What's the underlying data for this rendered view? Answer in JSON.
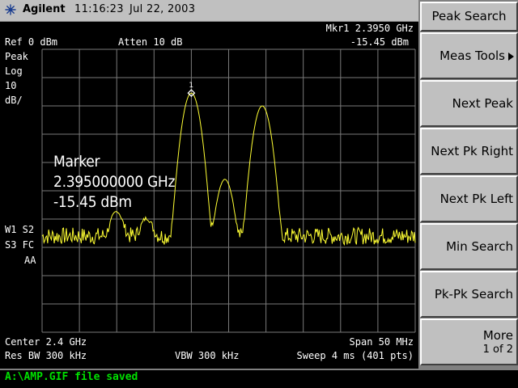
{
  "header": {
    "brand": "Agilent",
    "time": "11:16:23",
    "date": "Jul 22, 2003"
  },
  "display": {
    "ref_level": "Ref 0 dBm",
    "atten": "Atten 10 dB",
    "mkr_label": "Mkr1  2.3950 GHz",
    "mkr_amp": "-15.45 dBm",
    "detector": "Peak",
    "scale_type": "Log",
    "scale_value": "10",
    "scale_unit": "dB/",
    "trace_info_1": "W1  S2",
    "trace_info_2": "S3  FC",
    "trace_info_3": "AA",
    "marker_number": "1",
    "marker_annotation": {
      "title": "Marker",
      "frequency": "2.395000000 GHz",
      "amplitude": "-15.45 dBm"
    },
    "center": "Center 2.4 GHz",
    "span": "Span 50 MHz",
    "res_bw": "Res BW 300 kHz",
    "vbw": "VBW 300 kHz",
    "sweep": "Sweep 4 ms (401 pts)"
  },
  "softkeys": {
    "title": "Peak Search",
    "keys": [
      {
        "label": "Meas Tools"
      },
      {
        "label": "Next Peak"
      },
      {
        "label": "Next Pk Right"
      },
      {
        "label": "Next Pk Left"
      },
      {
        "label": "Min Search"
      },
      {
        "label": "Pk-Pk Search"
      },
      {
        "label": "More",
        "sub": "1 of 2"
      }
    ]
  },
  "status_message": "A:\\AMP.GIF file saved",
  "colors": {
    "trace": "#ffff33",
    "grid": "#7a7a7a",
    "status_text": "#00e000"
  },
  "icons": {
    "logo": "agilent-spark-icon",
    "submenu": "triangle-right-icon"
  },
  "spectrum": {
    "center_ghz": 2.4,
    "span_mhz": 50,
    "points": 401,
    "noise_floor_dbm": -66,
    "peaks": [
      {
        "freq_ghz": 2.385,
        "amp_dbm": -58
      },
      {
        "freq_ghz": 2.389,
        "amp_dbm": -61
      },
      {
        "freq_ghz": 2.395,
        "amp_dbm": -15.45
      },
      {
        "freq_ghz": 2.3995,
        "amp_dbm": -46
      },
      {
        "freq_ghz": 2.4045,
        "amp_dbm": -20
      }
    ]
  }
}
